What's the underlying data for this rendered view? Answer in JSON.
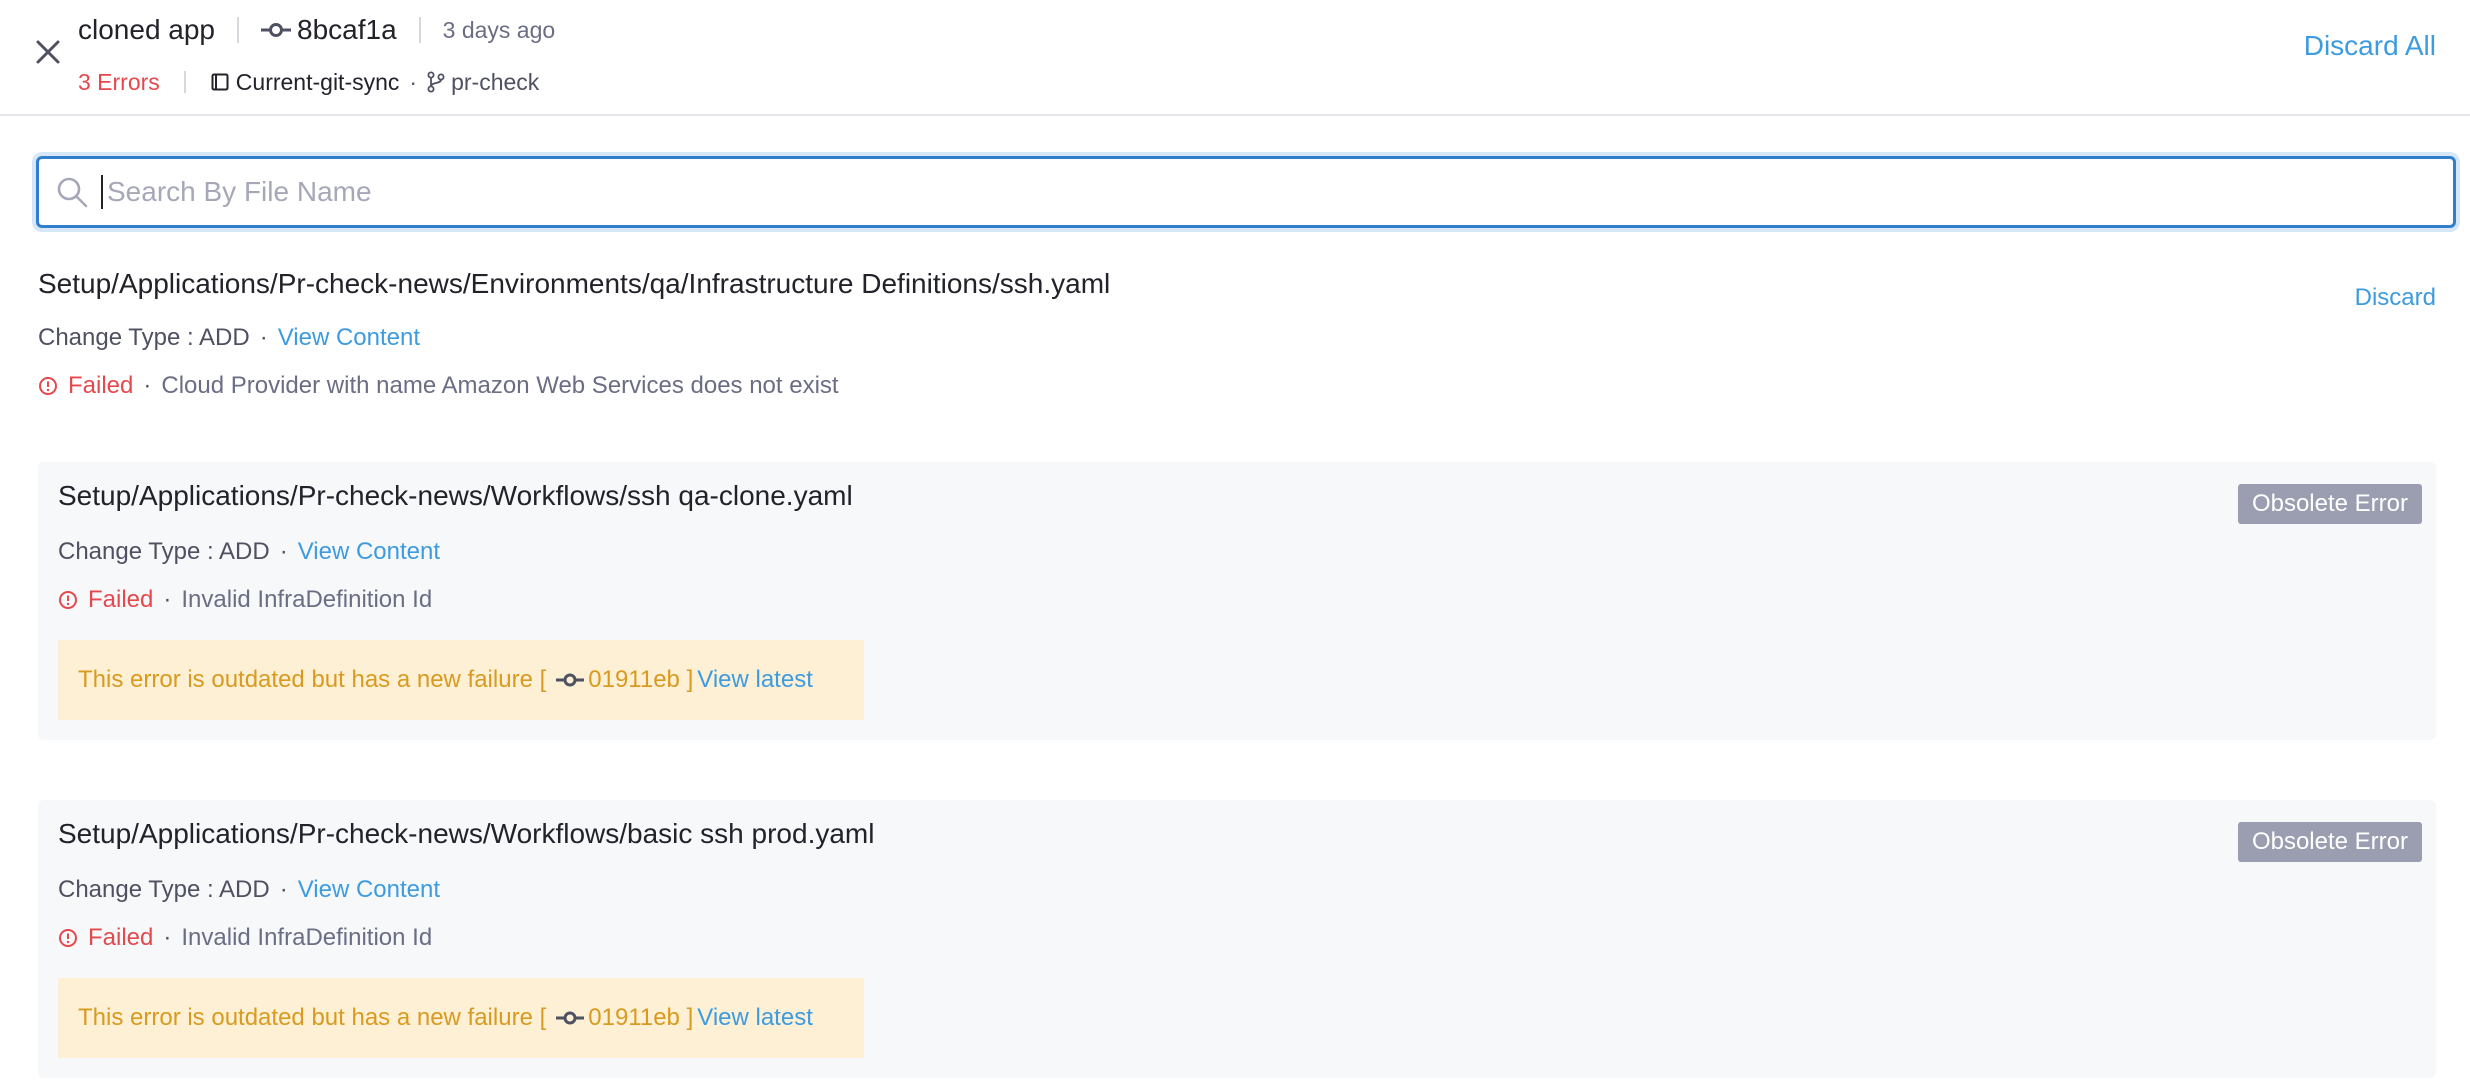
{
  "header": {
    "app_name": "cloned app",
    "commit_id": "8bcaf1a",
    "time_ago": "3 days ago",
    "error_count": "3 Errors",
    "repo_name": "Current-git-sync",
    "branch_name": "pr-check",
    "discard_all_label": "Discard All"
  },
  "search": {
    "placeholder": "Search By File Name",
    "value": ""
  },
  "entries": [
    {
      "path": "Setup/Applications/Pr-check-news/Environments/qa/Infrastructure Definitions/ssh.yaml",
      "change_type": "Change Type : ADD",
      "view_content": "View Content",
      "status": "Failed",
      "message": "Cloud Provider with name Amazon Web Services does not exist",
      "action_label": "Discard"
    },
    {
      "path": "Setup/Applications/Pr-check-news/Workflows/ssh qa-clone.yaml",
      "change_type": "Change Type : ADD",
      "view_content": "View Content",
      "status": "Failed",
      "message": "Invalid InfraDefinition Id",
      "badge": "Obsolete Error",
      "notice_text": "This error is outdated but has a new failure [",
      "notice_commit": "01911eb ]",
      "notice_link": "View latest"
    },
    {
      "path": "Setup/Applications/Pr-check-news/Workflows/basic ssh prod.yaml",
      "change_type": "Change Type : ADD",
      "view_content": "View Content",
      "status": "Failed",
      "message": "Invalid InfraDefinition Id",
      "badge": "Obsolete Error",
      "notice_text": "This error is outdated but has a new failure [",
      "notice_commit": "01911eb ]",
      "notice_link": "View latest"
    }
  ],
  "colors": {
    "accent": "#3d9be0",
    "error": "#e5484d",
    "warning_text": "#d99a1f",
    "warning_bg": "#fdf0d5",
    "badge_bg": "#9a9eb0"
  },
  "icons": {
    "close": "close-icon",
    "commit": "git-commit-icon",
    "repo": "book-icon",
    "branch": "git-branch-icon",
    "search": "search-icon",
    "alert": "alert-circle-icon"
  }
}
